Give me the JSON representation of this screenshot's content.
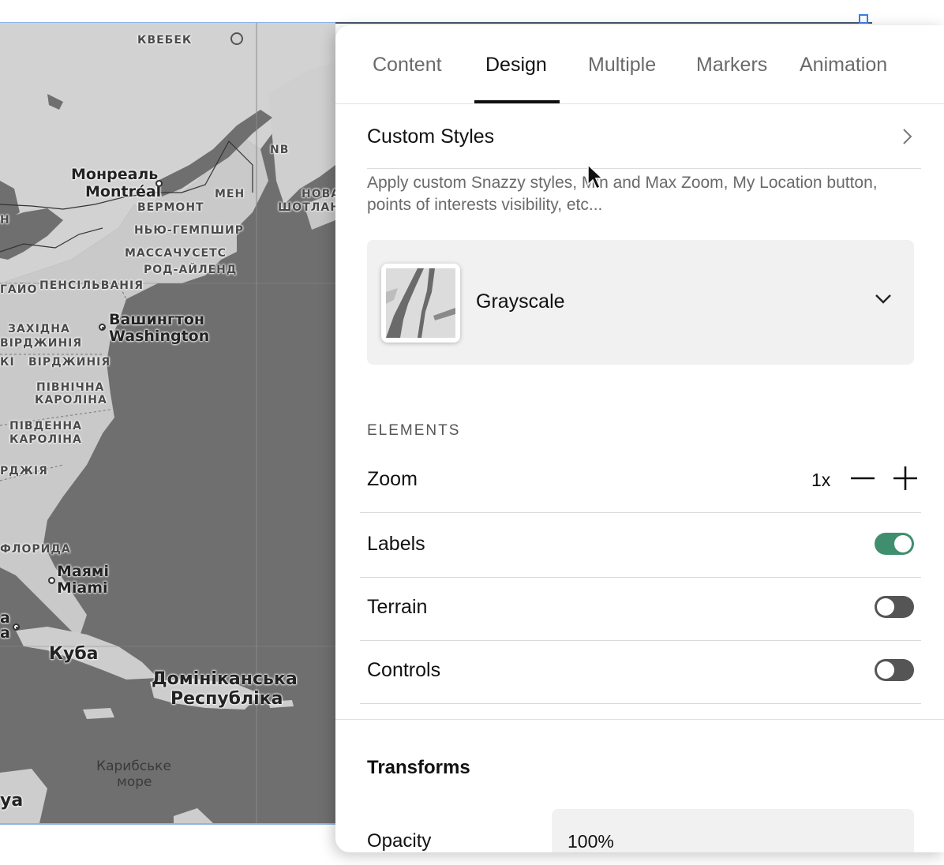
{
  "map": {
    "labels": {
      "quebec": "КВЕБЕК",
      "nb": "NB",
      "montreal_uk": "Монреаль",
      "montreal_en": "Montréal",
      "maine": "МЕН",
      "nova_scotia_1": "НОВА",
      "nova_scotia_2": "ШОТЛАН",
      "vermont": "ВЕРМОНТ",
      "new_hampshire": "НЬЮ-ГЕМПШИР",
      "massachusetts": "МАССАЧУСЕТС",
      "rhode_island": "РОД-АЙЛЕНД",
      "ohio": "ГАЙО",
      "pennsylvania": "ПЕНСІЛЬВАНІЯ",
      "washington_uk": "Вашингтон",
      "washington_en": "Washington",
      "west_virginia_1": "ЗАХІДНА",
      "west_virginia_2": "ВІРДЖИНІЯ",
      "virginia": "ВІРДЖИНІЯ",
      "ki": "КІ",
      "north_carolina_1": "ПІВНІЧНА",
      "north_carolina_2": "КАРОЛІНА",
      "south_carolina_1": "ПІВДЕННА",
      "south_carolina_2": "КАРОЛІНА",
      "georgia": "РДЖІЯ",
      "florida": "ФЛОРИДА",
      "miami_uk": "Маямі",
      "miami_en": "Miami",
      "cuba": "Куба",
      "dominican_1": "Домініканська",
      "dominican_2": "Республіка",
      "caribbean_1": "Карибське",
      "caribbean_2": "море",
      "edge_a1": "а",
      "edge_a2": "а",
      "edge_ya": "уа",
      "edge_h": "Н"
    }
  },
  "panel": {
    "tabs": [
      {
        "label": "Content"
      },
      {
        "label": "Design"
      },
      {
        "label": "Multiple"
      },
      {
        "label": "Markers"
      },
      {
        "label": "Animation"
      }
    ],
    "active_tab": "Design",
    "custom_styles": {
      "title": "Custom Styles",
      "description": "Apply custom Snazzy styles, Min and Max Zoom, My Location button, points of interests visibility, etc..."
    },
    "map_style": {
      "selected": "Grayscale"
    },
    "elements": {
      "heading": "ELEMENTS",
      "zoom": {
        "label": "Zoom",
        "value": "1x"
      },
      "labels": {
        "label": "Labels",
        "enabled": true
      },
      "terrain": {
        "label": "Terrain",
        "enabled": false
      },
      "controls": {
        "label": "Controls",
        "enabled": false
      }
    },
    "transforms": {
      "heading": "Transforms",
      "opacity": {
        "label": "Opacity",
        "value": "100%"
      }
    }
  },
  "colors": {
    "toggle_on": "#3f8f6e",
    "toggle_off": "#555555",
    "selection": "#3a7cf0"
  }
}
